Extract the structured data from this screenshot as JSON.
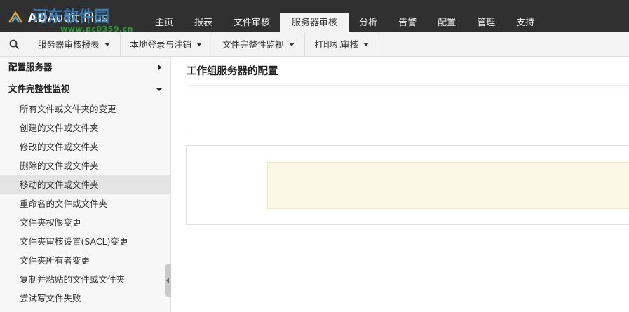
{
  "header": {
    "logo_text": "Audit Plus",
    "logo_prefix": "AD",
    "watermark_text": "河东软件园",
    "watermark_url": "www.pc0359.cn",
    "nav_tabs": [
      {
        "label": "主页",
        "active": false
      },
      {
        "label": "报表",
        "active": false
      },
      {
        "label": "文件审核",
        "active": false
      },
      {
        "label": "服务器审核",
        "active": true
      },
      {
        "label": "分析",
        "active": false
      },
      {
        "label": "告警",
        "active": false
      },
      {
        "label": "配置",
        "active": false
      },
      {
        "label": "管理",
        "active": false
      },
      {
        "label": "支持",
        "active": false
      }
    ]
  },
  "toolbar": {
    "items": [
      {
        "label": "服务器审核报表"
      },
      {
        "label": "本地登录与注销"
      },
      {
        "label": "文件完整性监视"
      },
      {
        "label": "打印机审核"
      }
    ]
  },
  "sidebar": {
    "section_config": "配置服务器",
    "section_fim": "文件完整性监视",
    "items": [
      {
        "label": "所有文件或文件夹的变更",
        "selected": false
      },
      {
        "label": "创建的文件或文件夹",
        "selected": false
      },
      {
        "label": "修改的文件或文件夹",
        "selected": false
      },
      {
        "label": "删除的文件或文件夹",
        "selected": false
      },
      {
        "label": "移动的文件或文件夹",
        "selected": true
      },
      {
        "label": "重命名的文件或文件夹",
        "selected": false
      },
      {
        "label": "文件夹权限变更",
        "selected": false
      },
      {
        "label": "文件夹审核设置(SACL)变更",
        "selected": false
      },
      {
        "label": "文件夹所有者变更",
        "selected": false
      },
      {
        "label": "复制并粘贴的文件或文件夹",
        "selected": false
      },
      {
        "label": "尝试写文件失败",
        "selected": false
      }
    ]
  },
  "main": {
    "title": "工作组服务器的配置"
  },
  "colors": {
    "topbar": "#303030",
    "active_tab": "#f3f3f3",
    "notice_bg": "#fdf7e6",
    "selected_row": "#e4e4e4"
  }
}
